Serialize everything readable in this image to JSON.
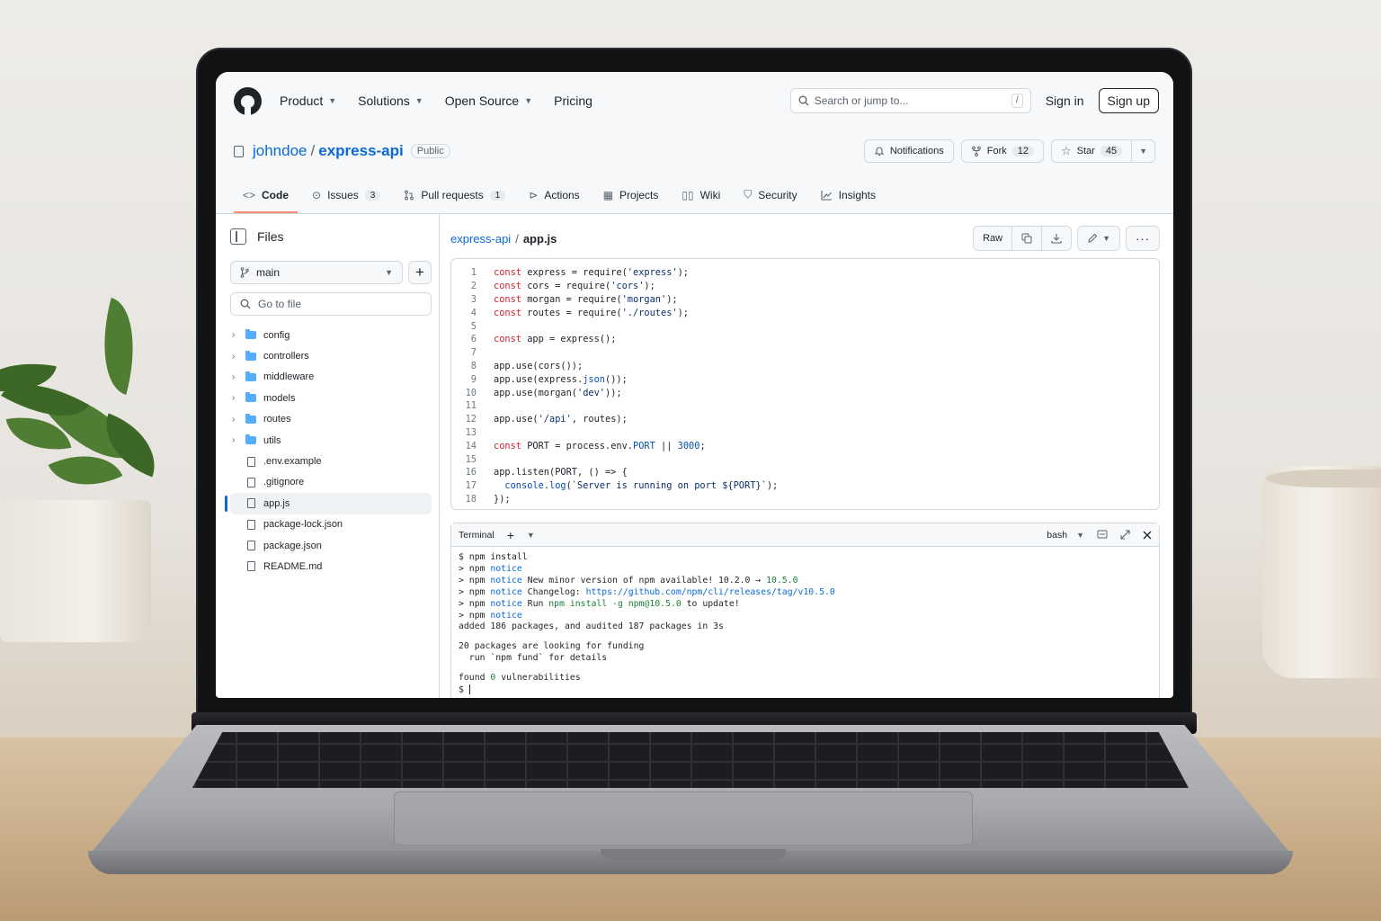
{
  "nav": {
    "items": [
      {
        "label": "Product",
        "dropdown": true
      },
      {
        "label": "Solutions",
        "dropdown": true
      },
      {
        "label": "Open Source",
        "dropdown": true
      },
      {
        "label": "Pricing",
        "dropdown": false
      }
    ],
    "search_placeholder": "Search or jump to...",
    "search_shortcut": "/",
    "sign_in": "Sign in",
    "sign_up": "Sign up"
  },
  "repo": {
    "owner": "johndoe",
    "name": "express-api",
    "visibility": "Public",
    "notifications_label": "Notifications",
    "fork_label": "Fork",
    "fork_count": "12",
    "star_label": "Star",
    "star_count": "45"
  },
  "tabs": [
    {
      "label": "Code",
      "icon": "code-icon",
      "count": null,
      "active": true
    },
    {
      "label": "Issues",
      "icon": "issue-icon",
      "count": "3",
      "active": false
    },
    {
      "label": "Pull requests",
      "icon": "pull-request-icon",
      "count": "1",
      "active": false
    },
    {
      "label": "Actions",
      "icon": "play-icon",
      "count": null,
      "active": false
    },
    {
      "label": "Projects",
      "icon": "table-icon",
      "count": null,
      "active": false
    },
    {
      "label": "Wiki",
      "icon": "book-icon",
      "count": null,
      "active": false
    },
    {
      "label": "Security",
      "icon": "shield-icon",
      "count": null,
      "active": false
    },
    {
      "label": "Insights",
      "icon": "graph-icon",
      "count": null,
      "active": false
    }
  ],
  "sidebar": {
    "title": "Files",
    "branch": "main",
    "goto_placeholder": "Go to file",
    "tree": [
      {
        "name": "config",
        "type": "folder"
      },
      {
        "name": "controllers",
        "type": "folder"
      },
      {
        "name": "middleware",
        "type": "folder"
      },
      {
        "name": "models",
        "type": "folder"
      },
      {
        "name": "routes",
        "type": "folder"
      },
      {
        "name": "utils",
        "type": "folder"
      },
      {
        "name": ".env.example",
        "type": "file"
      },
      {
        "name": ".gitignore",
        "type": "file"
      },
      {
        "name": "app.js",
        "type": "file",
        "selected": true
      },
      {
        "name": "package-lock.json",
        "type": "file"
      },
      {
        "name": "package.json",
        "type": "file"
      },
      {
        "name": "README.md",
        "type": "file"
      }
    ]
  },
  "file": {
    "repo_crumb": "express-api",
    "file_name": "app.js",
    "raw_label": "Raw",
    "lines": [
      "const express = require('express');",
      "const cors = require('cors');",
      "const morgan = require('morgan');",
      "const routes = require('./routes');",
      "",
      "const app = express();",
      "",
      "app.use(cors());",
      "app.use(express.json());",
      "app.use(morgan('dev'));",
      "",
      "app.use('/api', routes);",
      "",
      "const PORT = process.env.PORT || 3000;",
      "",
      "app.listen(PORT, () => {",
      "  console.log(`Server is running on port ${PORT}`);",
      "});"
    ]
  },
  "terminal": {
    "title": "Terminal",
    "shell": "bash",
    "lines": [
      "$ npm install",
      "> npm notice",
      "> npm notice New minor version of npm available! 10.2.0 → 10.5.0",
      "> npm notice Changelog: https://github.com/npm/cli/releases/tag/v10.5.0",
      "> npm notice Run npm install -g npm@10.5.0 to update!",
      "> npm notice",
      "added 186 packages, and audited 187 packages in 3s",
      "",
      "20 packages are looking for funding",
      "  run `npm fund` for details",
      "",
      "found 0 vulnerabilities",
      "$ "
    ]
  },
  "colors": {
    "link": "#0969da",
    "active_tab_underline": "#fd8c73",
    "folder": "#54aeff",
    "string": "#0a3069",
    "keyword": "#cf222e"
  }
}
